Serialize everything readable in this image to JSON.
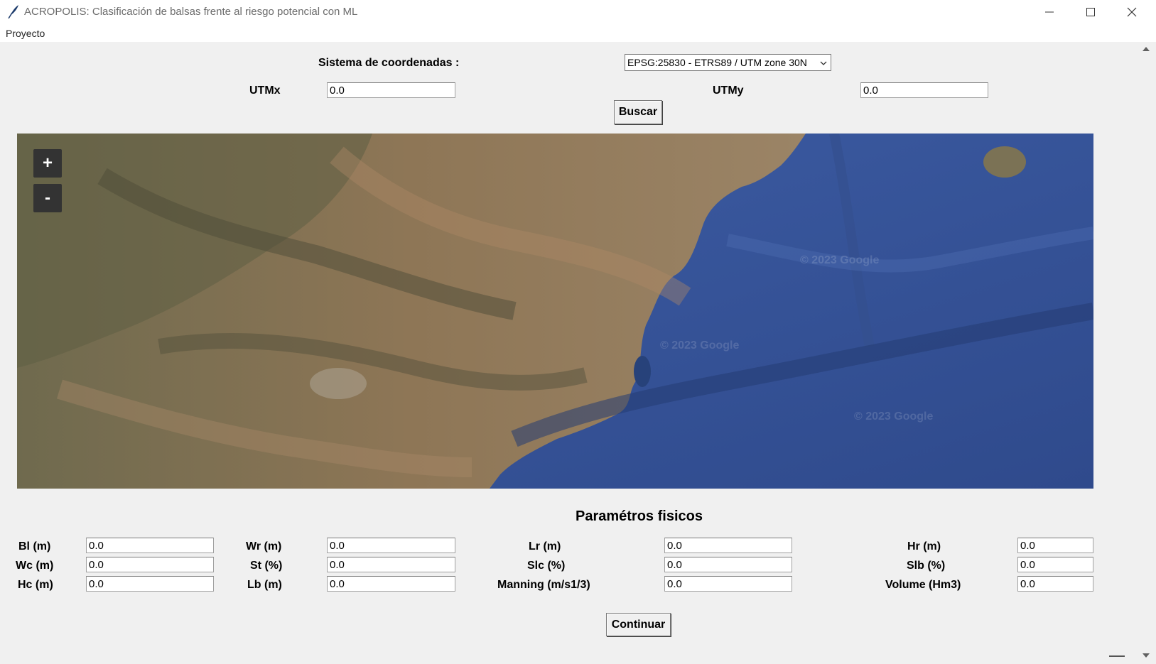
{
  "window": {
    "title": "ACROPOLIS: Clasificación de balsas frente al riesgo potencial con ML",
    "icon": "feather-icon"
  },
  "menu": {
    "items": [
      "Proyecto"
    ]
  },
  "coords": {
    "system_label": "Sistema de coordenadas :",
    "system_value": "EPSG:25830 - ETRS89 / UTM zone 30N",
    "utmx_label": "UTMx",
    "utmx_value": "0.0",
    "utmy_label": "UTMy",
    "utmy_value": "0.0",
    "search_button": "Buscar"
  },
  "map": {
    "zoom_in": "+",
    "zoom_out": "-",
    "watermarks": [
      "© 2023 Google",
      "© 2023 Google",
      "© 2023 Google"
    ],
    "land_color": "#8b7a5a",
    "sea_color": "#3d5a9e"
  },
  "params": {
    "title": "Paramétros fisicos",
    "rows": [
      [
        {
          "label": "Bl (m)",
          "value": "0.0"
        },
        {
          "label": "Wr (m)",
          "value": "0.0"
        },
        {
          "label": "Lr (m)",
          "value": "0.0"
        },
        {
          "label": "Hr (m)",
          "value": "0.0"
        }
      ],
      [
        {
          "label": "Wc (m)",
          "value": "0.0"
        },
        {
          "label": "St (%)",
          "value": "0.0"
        },
        {
          "label": "Slc (%)",
          "value": "0.0"
        },
        {
          "label": "Slb (%)",
          "value": "0.0"
        }
      ],
      [
        {
          "label": "Hc (m)",
          "value": "0.0"
        },
        {
          "label": "Lb (m)",
          "value": "0.0"
        },
        {
          "label": "Manning (m/s1/3)",
          "value": "0.0"
        },
        {
          "label": "Volume (Hm3)",
          "value": "0.0"
        }
      ]
    ],
    "continue_button": "Continuar"
  }
}
